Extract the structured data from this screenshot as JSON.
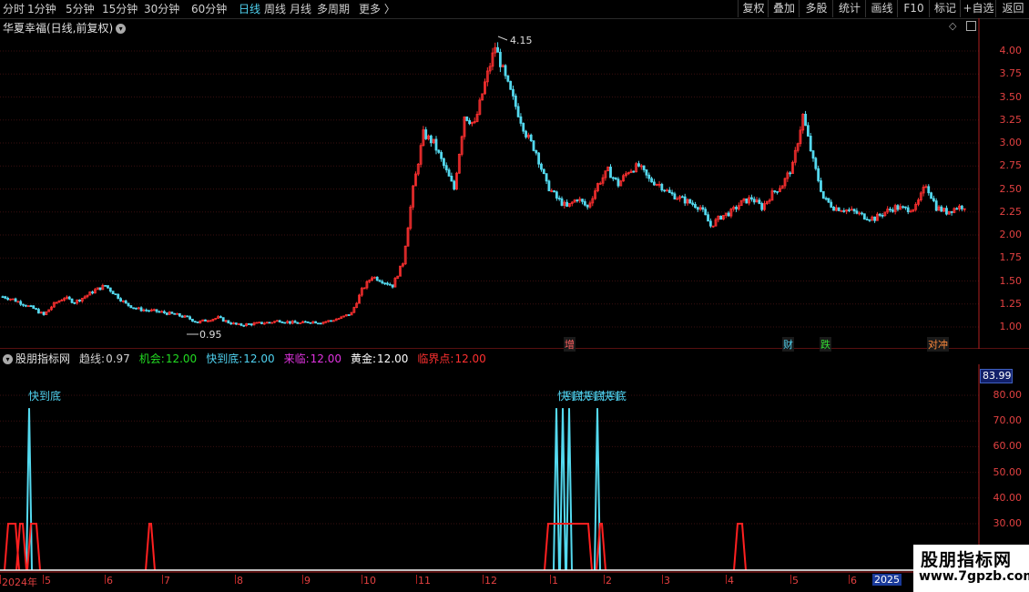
{
  "toolbar": {
    "periods": [
      "分时",
      "1分钟",
      "5分钟",
      "15分钟",
      "30分钟",
      "60分钟",
      "日线",
      "周线",
      "月线",
      "多周期",
      "更多 〉"
    ],
    "active_period": "日线",
    "right_buttons": [
      "复权",
      "叠加",
      "多股",
      "统计",
      "画线",
      "F10",
      "标记",
      "+自选",
      "返回"
    ]
  },
  "main_chart": {
    "title": "华夏幸福(日线,前复权)",
    "high_label": "4.15",
    "low_label": "0.95",
    "price_ticks": [
      "4.00",
      "3.75",
      "3.50",
      "3.25",
      "3.00",
      "2.75",
      "2.50",
      "2.25",
      "2.00",
      "1.75",
      "1.50",
      "1.25",
      "1.00"
    ],
    "event_markers": [
      {
        "text": "增",
        "color": "#ff6060"
      },
      {
        "text": "财",
        "color": "#4fd2f0"
      },
      {
        "text": "跌",
        "color": "#33dd33"
      },
      {
        "text": "对冲",
        "color": "#ff8a3c"
      }
    ]
  },
  "indicator": {
    "name": "股朋指标网",
    "items": [
      {
        "label": "趋线:",
        "value": "0.97",
        "color": "#d0d0d0"
      },
      {
        "label": "机会:",
        "value": "12.00",
        "color": "#22dd22"
      },
      {
        "label": "快到底:",
        "value": "12.00",
        "color": "#4fd2f0"
      },
      {
        "label": "来临:",
        "value": "12.00",
        "color": "#e033e0"
      },
      {
        "label": "黄金:",
        "value": "12.00",
        "color": "#ffffff"
      },
      {
        "label": "临界点:",
        "value": "12.00",
        "color": "#ff3030"
      }
    ],
    "current_value": "83.99",
    "ticks": [
      "80.00",
      "70.00",
      "60.00",
      "50.00",
      "40.00",
      "30.00"
    ],
    "signal_labels": [
      "快到底",
      "快到底快到底快到底"
    ]
  },
  "date_axis": {
    "labels": [
      "2024年",
      "5",
      "6",
      "7",
      "8",
      "9",
      "10",
      "11",
      "12",
      "1",
      "2",
      "3",
      "4",
      "5",
      "6"
    ],
    "year_end_label": "2025"
  },
  "watermark": {
    "title": "股朋指标网",
    "url": "www.7gpzb.com"
  },
  "colors": {
    "up": "#ff3030",
    "down": "#54d9ef",
    "axis": "#b02020",
    "grid": "#3a1010"
  },
  "chart_data": {
    "type": "candlestick",
    "x_range": [
      "2024-04",
      "2025-06"
    ],
    "y_range": [
      0.9,
      4.2
    ],
    "close_path_points": [
      1.33,
      1.3,
      1.25,
      1.2,
      1.13,
      1.25,
      1.32,
      1.27,
      1.33,
      1.4,
      1.45,
      1.35,
      1.25,
      1.2,
      1.18,
      1.17,
      1.15,
      1.13,
      1.1,
      1.05,
      1.08,
      1.1,
      1.05,
      1.02,
      1.03,
      1.04,
      1.05,
      1.07,
      1.05,
      1.04,
      1.06,
      1.05,
      1.07,
      1.1,
      1.15,
      1.4,
      1.55,
      1.5,
      1.45,
      1.7,
      2.5,
      3.1,
      3.0,
      2.75,
      2.5,
      3.3,
      3.2,
      3.65,
      4.05,
      3.7,
      3.4,
      3.1,
      2.9,
      2.55,
      2.4,
      2.3,
      2.4,
      2.3,
      2.55,
      2.7,
      2.55,
      2.7,
      2.75,
      2.6,
      2.55,
      2.45,
      2.4,
      2.35,
      2.3,
      2.1,
      2.2,
      2.25,
      2.35,
      2.4,
      2.3,
      2.45,
      2.55,
      2.75,
      3.3,
      2.8,
      2.4,
      2.3,
      2.28,
      2.25,
      2.2,
      2.18,
      2.25,
      2.3,
      2.28,
      2.3,
      2.55,
      2.3,
      2.25,
      2.3,
      2.32
    ]
  }
}
